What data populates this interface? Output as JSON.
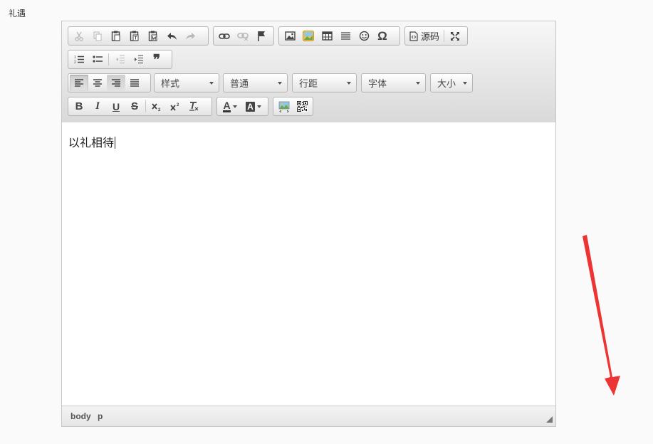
{
  "field": {
    "label": "礼遇"
  },
  "toolbar": {
    "row1": {
      "clipboard": [
        "cut-icon",
        "copy-icon",
        "paste-icon",
        "paste-text-icon",
        "paste-from-word-icon",
        "undo-icon",
        "redo-icon"
      ],
      "links": [
        "link-icon",
        "unlink-icon",
        "anchor-icon"
      ],
      "insert": [
        "image-icon",
        "flash-icon",
        "table-icon",
        "horizontal-rule-icon",
        "smiley-icon",
        "special-char-icon"
      ],
      "source_label": "源码",
      "maximize": "maximize-icon"
    },
    "row2": [
      "numbered-list-icon",
      "bulleted-list-icon",
      "outdent-icon",
      "indent-icon",
      "blockquote-icon"
    ],
    "row3": {
      "align": [
        "align-left-icon",
        "align-center-icon",
        "align-right-icon",
        "align-justify-icon"
      ],
      "combos": {
        "style": "样式",
        "format": "普通",
        "line_height": "行距",
        "font": "字体",
        "size": "大小"
      }
    },
    "row4": {
      "basic": [
        "bold-icon",
        "italic-icon",
        "underline-icon",
        "strike-icon",
        "subscript-icon",
        "superscript-icon",
        "remove-format-icon"
      ],
      "colors": [
        "text-color-icon",
        "bg-color-icon"
      ],
      "extra": [
        "image-upload-icon",
        "qrcode-icon"
      ],
      "labels": {
        "bold": "B",
        "italic": "I",
        "underline": "U",
        "strike": "S",
        "text_color": "A",
        "bg_color": "A"
      }
    }
  },
  "content": {
    "text": "以礼相待"
  },
  "statusbar": {
    "path": [
      "body",
      "p"
    ]
  },
  "colors": {
    "accent_arrow": "#ee3333"
  }
}
